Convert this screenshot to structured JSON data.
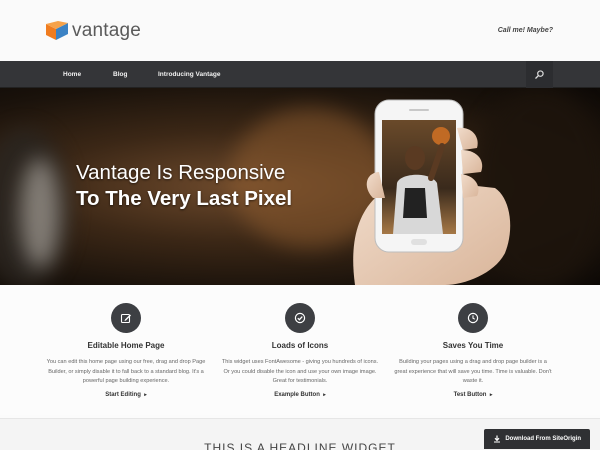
{
  "header": {
    "logo_text": "vantage",
    "tagline": "Call me! Maybe?"
  },
  "nav": {
    "items": [
      {
        "label": "Home"
      },
      {
        "label": "Blog"
      },
      {
        "label": "Introducing Vantage"
      }
    ],
    "search_icon": "search-icon"
  },
  "hero": {
    "line1": "Vantage Is Responsive",
    "line2": "To The Very Last Pixel"
  },
  "features": [
    {
      "icon": "edit-icon",
      "title": "Editable Home Page",
      "text": "You can edit this home page using our free, drag and drop Page Builder, or simply disable it to fall back to a standard blog. It's a powerful page building experience.",
      "link": "Start Editing"
    },
    {
      "icon": "check-circle-icon",
      "title": "Loads of Icons",
      "text": "This widget uses FontAwesome - giving you hundreds of icons. Or you could disable the icon and use your own image image. Great for testimonials.",
      "link": "Example Button"
    },
    {
      "icon": "clock-icon",
      "title": "Saves You Time",
      "text": "Building your pages using a drag and drop page builder is a great experience that will save you time. Time is valuable. Don't waste it.",
      "link": "Test Button"
    }
  ],
  "headline_widget": "THIS IS A HEADLINE WIDGET",
  "download_button": "Download From SiteOrigin",
  "colors": {
    "nav_bg": "#343538",
    "feature_icon_bg": "#3d3f43",
    "logo_orange": "#f07c1f",
    "logo_blue": "#3b82c4"
  }
}
